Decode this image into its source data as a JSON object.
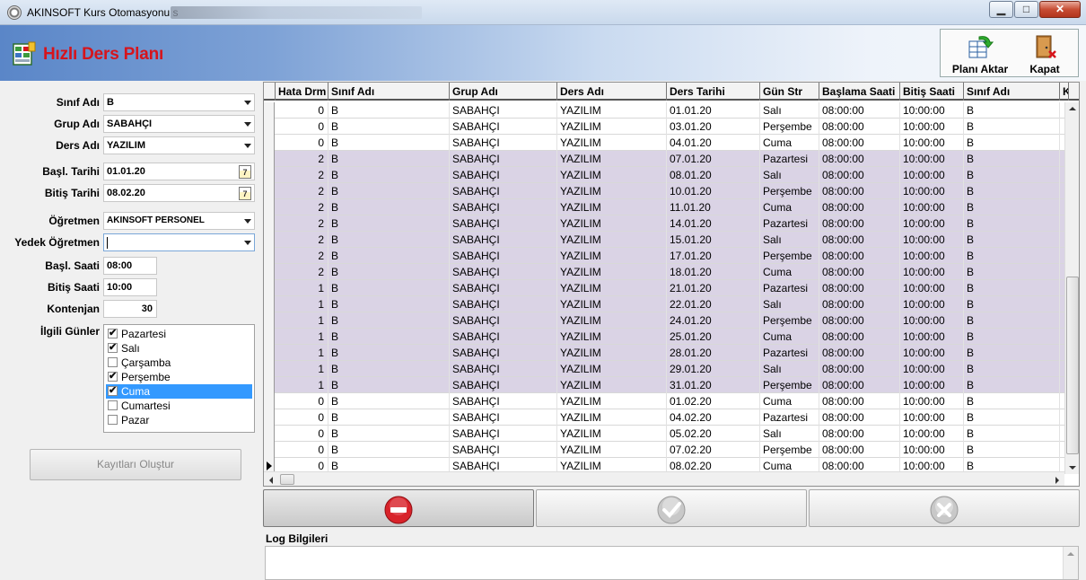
{
  "window": {
    "title": "AKINSOFT Kurs Otomasyonu s",
    "app_icon": "gear-clock-icon"
  },
  "header": {
    "title": "Hızlı Ders Planı",
    "icon": "plan-grid-icon",
    "title_color": "#d6141c",
    "toolbar": {
      "transfer_label": "Planı Aktar",
      "close_label": "Kapat"
    }
  },
  "form": {
    "sinif_label": "Sınıf Adı",
    "sinif_value": "B",
    "grup_label": "Grup Adı",
    "grup_value": "SABAHÇI",
    "ders_label": "Ders Adı",
    "ders_value": "YAZILIM",
    "basl_tarihi_label": "Başl. Tarihi",
    "basl_tarihi_value": "01.01.20",
    "bitis_tarihi_label": "Bitiş Tarihi",
    "bitis_tarihi_value": "08.02.20",
    "calendar_glyph": "7",
    "ogretmen_label": "Öğretmen",
    "ogretmen_value": "AKINSOFT PERSONEL",
    "yedek_label": "Yedek Öğretmen",
    "yedek_value": "",
    "basl_saati_label": "Başl. Saati",
    "basl_saati_value": "08:00",
    "bitis_saati_label": "Bitiş Saati",
    "bitis_saati_value": "10:00",
    "kontenjan_label": "Kontenjan",
    "kontenjan_value": "30",
    "gunler_label": "İlgili Günler",
    "days": [
      {
        "label": "Pazartesi",
        "checked": true,
        "selected": false
      },
      {
        "label": "Salı",
        "checked": true,
        "selected": false
      },
      {
        "label": "Çarşamba",
        "checked": false,
        "selected": false
      },
      {
        "label": "Perşembe",
        "checked": true,
        "selected": false
      },
      {
        "label": "Cuma",
        "checked": true,
        "selected": true
      },
      {
        "label": "Cumartesi",
        "checked": false,
        "selected": false
      },
      {
        "label": "Pazar",
        "checked": false,
        "selected": false
      }
    ],
    "create_button": "Kayıtları Oluştur"
  },
  "grid": {
    "columns": [
      "Hata Drm",
      "Sınıf Adı",
      "Grup Adı",
      "Ders Adı",
      "Ders Tarihi",
      "Gün Str",
      "Başlama Saati",
      "Bitiş Saati",
      "Sınıf Adı",
      "K"
    ],
    "error_row_color": "#dad3e5",
    "rows": [
      [
        "0",
        "B",
        "SABAHÇI",
        "YAZILIM",
        "01.01.20",
        "Salı",
        "08:00:00",
        "10:00:00",
        "B"
      ],
      [
        "0",
        "B",
        "SABAHÇI",
        "YAZILIM",
        "03.01.20",
        "Perşembe",
        "08:00:00",
        "10:00:00",
        "B"
      ],
      [
        "0",
        "B",
        "SABAHÇI",
        "YAZILIM",
        "04.01.20",
        "Cuma",
        "08:00:00",
        "10:00:00",
        "B"
      ],
      [
        "2",
        "B",
        "SABAHÇI",
        "YAZILIM",
        "07.01.20",
        "Pazartesi",
        "08:00:00",
        "10:00:00",
        "B"
      ],
      [
        "2",
        "B",
        "SABAHÇI",
        "YAZILIM",
        "08.01.20",
        "Salı",
        "08:00:00",
        "10:00:00",
        "B"
      ],
      [
        "2",
        "B",
        "SABAHÇI",
        "YAZILIM",
        "10.01.20",
        "Perşembe",
        "08:00:00",
        "10:00:00",
        "B"
      ],
      [
        "2",
        "B",
        "SABAHÇI",
        "YAZILIM",
        "11.01.20",
        "Cuma",
        "08:00:00",
        "10:00:00",
        "B"
      ],
      [
        "2",
        "B",
        "SABAHÇI",
        "YAZILIM",
        "14.01.20",
        "Pazartesi",
        "08:00:00",
        "10:00:00",
        "B"
      ],
      [
        "2",
        "B",
        "SABAHÇI",
        "YAZILIM",
        "15.01.20",
        "Salı",
        "08:00:00",
        "10:00:00",
        "B"
      ],
      [
        "2",
        "B",
        "SABAHÇI",
        "YAZILIM",
        "17.01.20",
        "Perşembe",
        "08:00:00",
        "10:00:00",
        "B"
      ],
      [
        "2",
        "B",
        "SABAHÇI",
        "YAZILIM",
        "18.01.20",
        "Cuma",
        "08:00:00",
        "10:00:00",
        "B"
      ],
      [
        "1",
        "B",
        "SABAHÇI",
        "YAZILIM",
        "21.01.20",
        "Pazartesi",
        "08:00:00",
        "10:00:00",
        "B"
      ],
      [
        "1",
        "B",
        "SABAHÇI",
        "YAZILIM",
        "22.01.20",
        "Salı",
        "08:00:00",
        "10:00:00",
        "B"
      ],
      [
        "1",
        "B",
        "SABAHÇI",
        "YAZILIM",
        "24.01.20",
        "Perşembe",
        "08:00:00",
        "10:00:00",
        "B"
      ],
      [
        "1",
        "B",
        "SABAHÇI",
        "YAZILIM",
        "25.01.20",
        "Cuma",
        "08:00:00",
        "10:00:00",
        "B"
      ],
      [
        "1",
        "B",
        "SABAHÇI",
        "YAZILIM",
        "28.01.20",
        "Pazartesi",
        "08:00:00",
        "10:00:00",
        "B"
      ],
      [
        "1",
        "B",
        "SABAHÇI",
        "YAZILIM",
        "29.01.20",
        "Salı",
        "08:00:00",
        "10:00:00",
        "B"
      ],
      [
        "1",
        "B",
        "SABAHÇI",
        "YAZILIM",
        "31.01.20",
        "Perşembe",
        "08:00:00",
        "10:00:00",
        "B"
      ],
      [
        "0",
        "B",
        "SABAHÇI",
        "YAZILIM",
        "01.02.20",
        "Cuma",
        "08:00:00",
        "10:00:00",
        "B"
      ],
      [
        "0",
        "B",
        "SABAHÇI",
        "YAZILIM",
        "04.02.20",
        "Pazartesi",
        "08:00:00",
        "10:00:00",
        "B"
      ],
      [
        "0",
        "B",
        "SABAHÇI",
        "YAZILIM",
        "05.02.20",
        "Salı",
        "08:00:00",
        "10:00:00",
        "B"
      ],
      [
        "0",
        "B",
        "SABAHÇI",
        "YAZILIM",
        "07.02.20",
        "Perşembe",
        "08:00:00",
        "10:00:00",
        "B"
      ],
      [
        "0",
        "B",
        "SABAHÇI",
        "YAZILIM",
        "08.02.20",
        "Cuma",
        "08:00:00",
        "10:00:00",
        "B"
      ]
    ],
    "current_row": 22
  },
  "actions": {
    "delete_icon": "no-entry-icon",
    "confirm_icon": "check-circle-icon",
    "cancel_icon": "x-circle-icon"
  },
  "log": {
    "label": "Log Bilgileri",
    "content": ""
  }
}
